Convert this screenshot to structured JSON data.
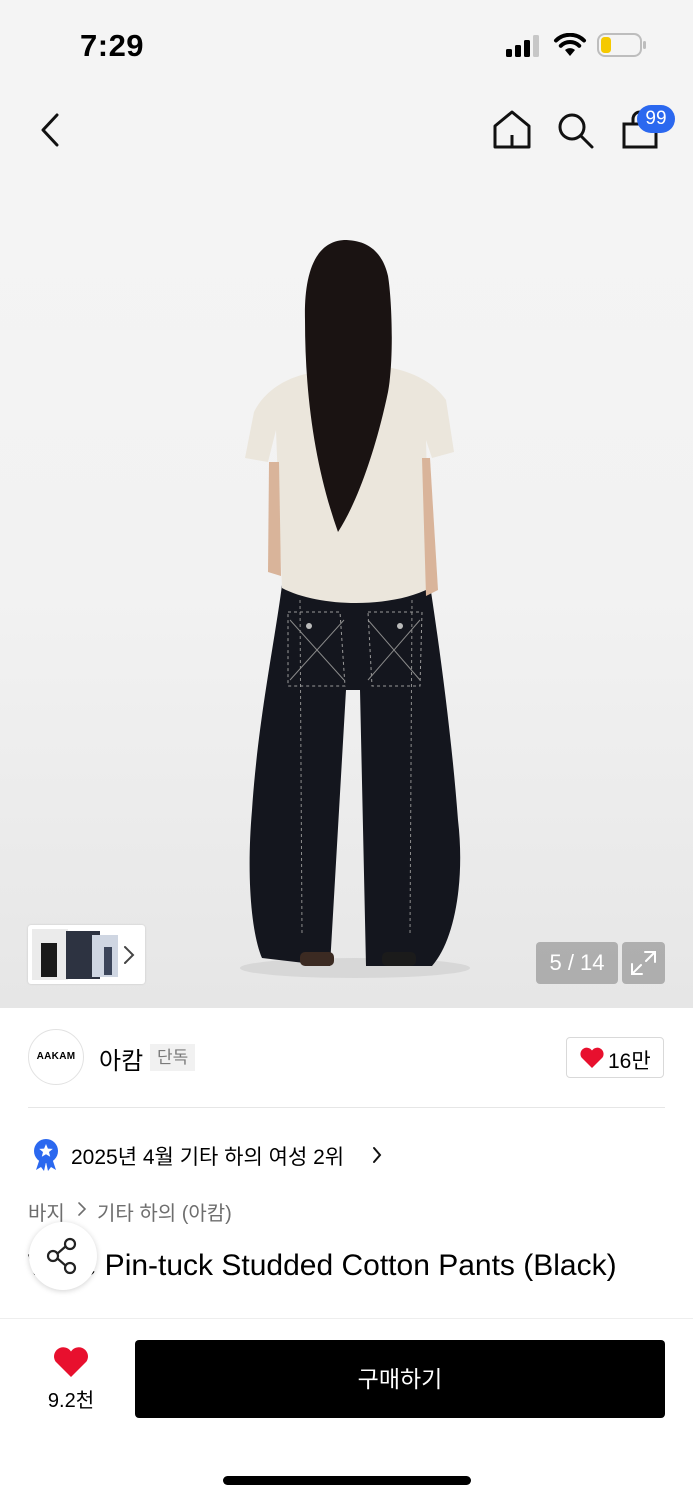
{
  "status_bar": {
    "time": "7:29"
  },
  "header": {
    "cart_badge": "99",
    "icons": [
      "back-icon",
      "home-icon",
      "search-icon",
      "cart-icon"
    ]
  },
  "gallery": {
    "counter": "5 / 14"
  },
  "brand": {
    "logo_text": "AAKAM",
    "name": "아캄",
    "tag": "단독",
    "likes": "16만"
  },
  "ranking": {
    "text": "2025년 4월 기타 하의 여성 2위"
  },
  "breadcrumb": {
    "level1": "바지",
    "level2": "기타 하의 (아캄)"
  },
  "product": {
    "title": "Wide Pin-tuck Studded Cotton Pants (Black)"
  },
  "bottom_bar": {
    "wish_count": "9.2천",
    "buy_label": "구매하기"
  },
  "colors": {
    "accent_blue": "#2b68ef",
    "heart_red": "#e8102e",
    "buy_button": "#000000"
  }
}
